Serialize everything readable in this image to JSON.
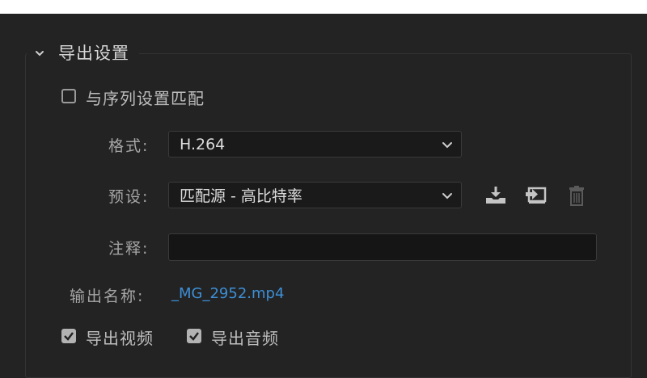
{
  "export_settings": {
    "title": "导出设置",
    "match_sequence": {
      "label": "与序列设置匹配",
      "checked": false
    },
    "format": {
      "label": "格式:",
      "value": "H.264"
    },
    "preset": {
      "label": "预设:",
      "value": "匹配源 - 高比特率"
    },
    "comments": {
      "label": "注释:",
      "value": ""
    },
    "output_name": {
      "label": "输出名称:",
      "value": "_MG_2952.mp4"
    },
    "export_video": {
      "label": "导出视频",
      "checked": true
    },
    "export_audio": {
      "label": "导出音频",
      "checked": true
    },
    "icons": {
      "collapse": "chevron-down-icon",
      "save_preset": "save-preset-icon",
      "import_preset": "import-preset-icon",
      "delete_preset": "trash-icon"
    },
    "colors": {
      "link": "#3d8fd6",
      "panel_bg": "#232323"
    }
  }
}
